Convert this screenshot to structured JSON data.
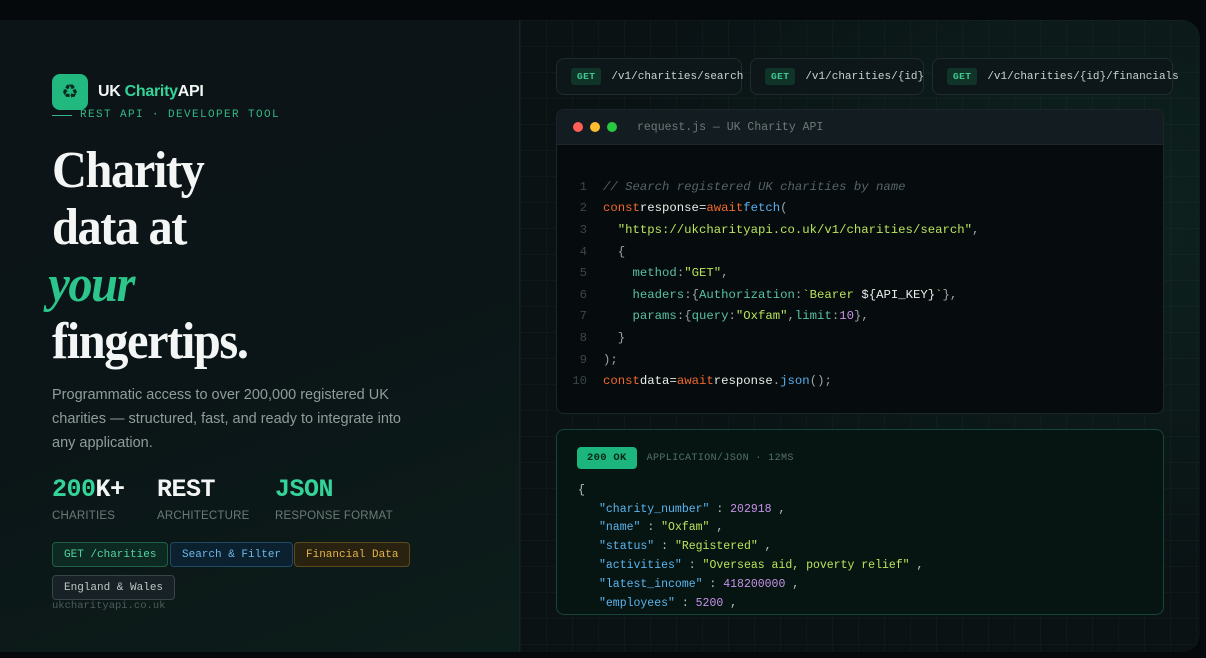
{
  "brand": {
    "logo_glyph": "♻",
    "name_part1": "UK",
    "name_part2": "Charity",
    "name_part3": "API",
    "tagline": "REST API · DEVELOPER TOOL"
  },
  "hero": {
    "line1": "Charity",
    "line2": "data at",
    "line3_accent": "your",
    "line4": "fingertips.",
    "description": "Programmatic access to over 200,000 registered UK charities — structured, fast, and ready to integrate into any application."
  },
  "stats": [
    {
      "value_accent": "200",
      "value_rest": "K+",
      "label": "CHARITIES"
    },
    {
      "value_accent": "",
      "value_rest": "REST",
      "label": "ARCHITECTURE"
    },
    {
      "value_accent": "JSON",
      "value_rest": "",
      "label": "RESPONSE FORMAT"
    }
  ],
  "tags": [
    "GET /charities",
    "Search & Filter",
    "Financial Data",
    "England & Wales"
  ],
  "footer_url": "ukcharityapi.co.uk",
  "endpoints": [
    {
      "method": "GET",
      "path": "/v1/charities/search"
    },
    {
      "method": "GET",
      "path": "/v1/charities/{id}"
    },
    {
      "method": "GET",
      "path": "/v1/charities/{id}/financials"
    }
  ],
  "code_window": {
    "title": "request.js — UK Charity API",
    "lines": [
      [
        [
          "c-com",
          "// Search registered UK charities by name"
        ]
      ],
      [
        [
          "c-kw",
          "const"
        ],
        [
          "c-var",
          "response"
        ],
        [
          "c-op",
          "="
        ],
        [
          "c-kw",
          "await"
        ],
        [
          "c-fn",
          "fetch"
        ],
        [
          "c-punc",
          "("
        ]
      ],
      [
        [
          "c-punc",
          "  "
        ],
        [
          "c-str",
          "\"https://ukcharityapi.co.uk/v1/charities/search\""
        ],
        [
          "c-punc",
          ","
        ]
      ],
      [
        [
          "c-punc",
          "  {"
        ]
      ],
      [
        [
          "c-punc",
          "    "
        ],
        [
          "c-prop",
          "method"
        ],
        [
          "c-punc",
          ":"
        ],
        [
          "c-str",
          "\"GET\""
        ],
        [
          "c-punc",
          ","
        ]
      ],
      [
        [
          "c-punc",
          "    "
        ],
        [
          "c-prop",
          "headers"
        ],
        [
          "c-punc",
          ":{"
        ],
        [
          "c-prop",
          "Authorization"
        ],
        [
          "c-punc",
          ":"
        ],
        [
          "c-str",
          "`Bearer "
        ],
        [
          "c-var",
          "${"
        ],
        [
          "c-var",
          "API_KEY"
        ],
        [
          "c-var",
          "}"
        ],
        [
          "c-str",
          "`"
        ],
        [
          "c-punc",
          "},"
        ]
      ],
      [
        [
          "c-punc",
          "    "
        ],
        [
          "c-prop",
          "params"
        ],
        [
          "c-punc",
          ":{"
        ],
        [
          "c-prop",
          "query"
        ],
        [
          "c-punc",
          ":"
        ],
        [
          "c-str",
          "\"Oxfam\""
        ],
        [
          "c-punc",
          ","
        ],
        [
          "c-prop",
          "limit"
        ],
        [
          "c-punc",
          ":"
        ],
        [
          "c-num",
          "10"
        ],
        [
          "c-punc",
          "},"
        ]
      ],
      [
        [
          "c-punc",
          "  }"
        ]
      ],
      [
        [
          "c-punc",
          ");"
        ]
      ],
      [
        [
          "c-kw",
          "const"
        ],
        [
          "c-var",
          "data"
        ],
        [
          "c-op",
          "="
        ],
        [
          "c-kw",
          "await"
        ],
        [
          "c-var",
          "response"
        ],
        [
          "c-punc",
          "."
        ],
        [
          "c-fn",
          "json"
        ],
        [
          "c-punc",
          "();"
        ]
      ]
    ]
  },
  "response": {
    "status": "200 OK",
    "meta": "APPLICATION/JSON · 12MS",
    "open_brace": "{",
    "fields": [
      {
        "key": "\"charity_number\"",
        "value": "202918",
        "type": "num"
      },
      {
        "key": "\"name\"",
        "value": "\"Oxfam\"",
        "type": "str"
      },
      {
        "key": "\"status\"",
        "value": "\"Registered\"",
        "type": "str"
      },
      {
        "key": "\"activities\"",
        "value": "\"Overseas aid, poverty relief\"",
        "type": "str"
      },
      {
        "key": "\"latest_income\"",
        "value": "418200000",
        "type": "num"
      },
      {
        "key": "\"employees\"",
        "value": "5200",
        "type": "num"
      }
    ]
  },
  "colors": {
    "accent": "#34d399",
    "background": "#080f12",
    "dot_red": "#ff5f57",
    "dot_yellow": "#febc2e",
    "dot_green": "#28c840"
  }
}
